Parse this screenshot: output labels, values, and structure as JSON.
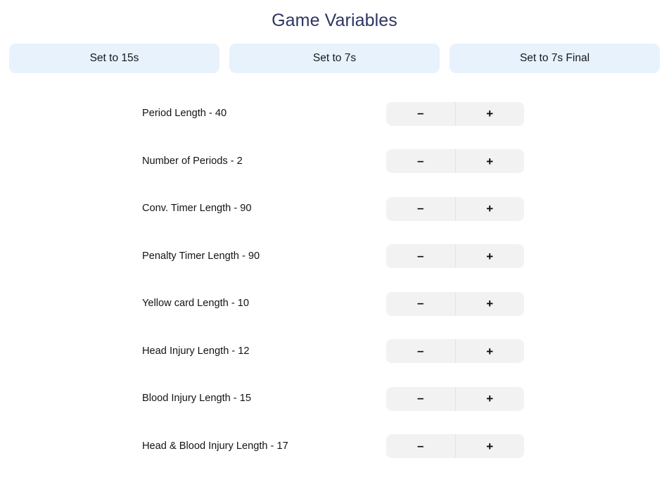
{
  "header": {
    "title": "Game Variables"
  },
  "presets": {
    "buttons": [
      {
        "label": "Set to 15s",
        "name": "preset-15s"
      },
      {
        "label": "Set to 7s",
        "name": "preset-7s"
      },
      {
        "label": "Set to 7s Final",
        "name": "preset-7s-final"
      }
    ]
  },
  "stepper": {
    "decrement_label": "–",
    "increment_label": "+"
  },
  "colors": {
    "title": "#2e3561",
    "preset_button_bg": "#e8f2fd",
    "preset_button_text": "#15181d",
    "stepper_bg": "#f2f2f2",
    "stepper_divider": "#e4e4e4",
    "label_text": "#111418",
    "page_bg": "#ffffff"
  },
  "variables": [
    {
      "label": "Period Length - 40",
      "name": "period-length",
      "value": 40
    },
    {
      "label": "Number of Periods - 2",
      "name": "number-of-periods",
      "value": 2
    },
    {
      "label": "Conv. Timer Length - 90",
      "name": "conv-timer-length",
      "value": 90
    },
    {
      "label": "Penalty Timer Length - 90",
      "name": "penalty-timer-length",
      "value": 90
    },
    {
      "label": "Yellow card Length - 10",
      "name": "yellow-card-length",
      "value": 10
    },
    {
      "label": "Head Injury Length - 12",
      "name": "head-injury-length",
      "value": 12
    },
    {
      "label": "Blood Injury Length - 15",
      "name": "blood-injury-length",
      "value": 15
    },
    {
      "label": "Head & Blood Injury Length - 17",
      "name": "head-and-blood-injury-length",
      "value": 17
    }
  ]
}
